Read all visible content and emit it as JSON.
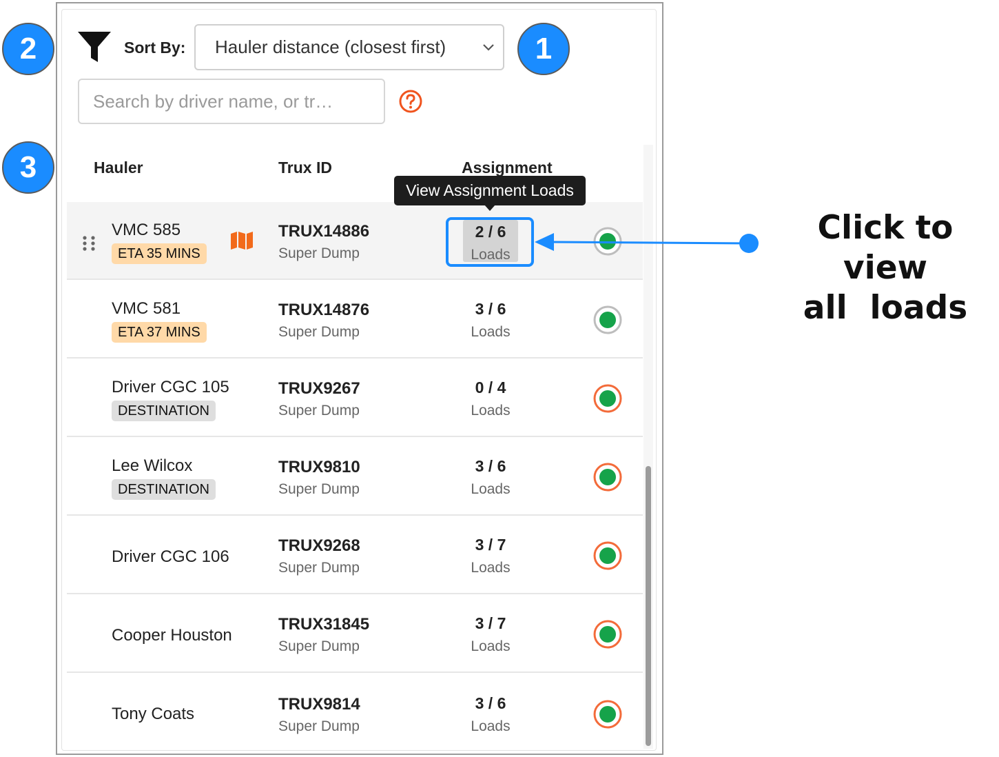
{
  "toolbar": {
    "sort_label": "Sort By:",
    "sort_value": "Hauler distance (closest first)",
    "search_placeholder": "Search by driver name, or tr…"
  },
  "steps": [
    "2",
    "1",
    "3"
  ],
  "columns": {
    "hauler": "Hauler",
    "trux_id": "Trux ID",
    "assignment": "Assignment"
  },
  "tooltip": "View Assignment Loads",
  "annotation": {
    "line1": "Click to view",
    "line2": "all  loads"
  },
  "colors": {
    "accent": "#1a8cff",
    "status_grey_ring": "#bdbdbd",
    "status_orange_ring": "#f36b3a",
    "status_fill": "#16a34a"
  },
  "rows": [
    {
      "name": "VMC 585",
      "badge": "ETA 35 MINS",
      "badge_type": "eta",
      "trux": "TRUX14886",
      "type": "Super Dump",
      "count": "2 / 6",
      "unit": "Loads",
      "status": "grey",
      "highlighted": true,
      "map_icon": true
    },
    {
      "name": "VMC 581",
      "badge": "ETA 37 MINS",
      "badge_type": "eta",
      "trux": "TRUX14876",
      "type": "Super Dump",
      "count": "3 / 6",
      "unit": "Loads",
      "status": "grey"
    },
    {
      "name": "Driver CGC 105",
      "badge": "DESTINATION",
      "badge_type": "dest",
      "trux": "TRUX9267",
      "type": "Super Dump",
      "count": "0 / 4",
      "unit": "Loads",
      "status": "orange"
    },
    {
      "name": "Lee Wilcox",
      "badge": "DESTINATION",
      "badge_type": "dest",
      "trux": "TRUX9810",
      "type": "Super Dump",
      "count": "3 / 6",
      "unit": "Loads",
      "status": "orange"
    },
    {
      "name": "Driver CGC 106",
      "trux": "TRUX9268",
      "type": "Super Dump",
      "count": "3 / 7",
      "unit": "Loads",
      "status": "orange"
    },
    {
      "name": "Cooper Houston",
      "trux": "TRUX31845",
      "type": "Super Dump",
      "count": "3 / 7",
      "unit": "Loads",
      "status": "orange"
    },
    {
      "name": "Tony Coats",
      "trux": "TRUX9814",
      "type": "Super Dump",
      "count": "3 / 6",
      "unit": "Loads",
      "status": "orange"
    }
  ]
}
